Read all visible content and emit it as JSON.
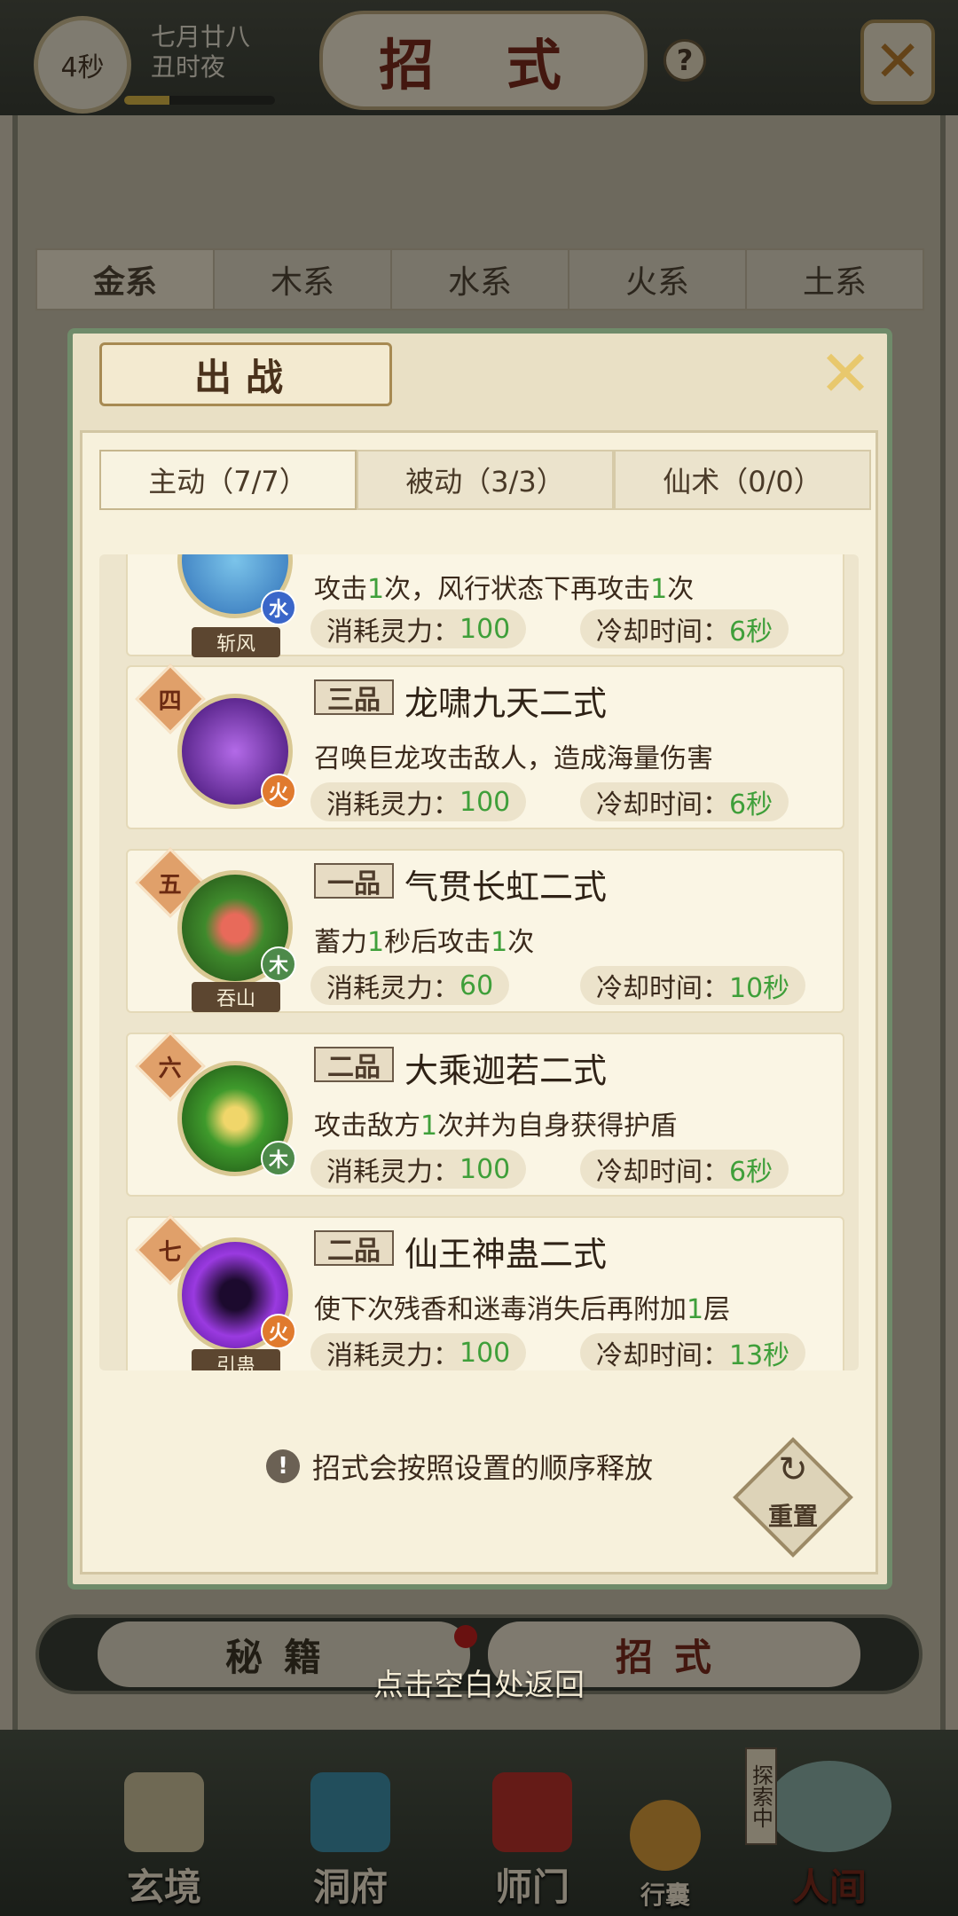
{
  "status": {
    "timer": "4秒",
    "date_line1": "七月廿八",
    "date_line2": "丑时夜"
  },
  "page_title": "招 式",
  "element_tabs": [
    "金系",
    "木系",
    "水系",
    "火系",
    "土系"
  ],
  "bottom_tabs": {
    "left": "秘籍",
    "right": "招式"
  },
  "nav": {
    "items": [
      "玄境",
      "洞府",
      "师门",
      "行囊",
      "人间"
    ],
    "explore_badge": "探索中"
  },
  "dialog": {
    "title": "出战",
    "tabs": [
      "主动（7/7）",
      "被动（3/3）",
      "仙术（0/0）"
    ],
    "cost_label": "消耗灵力：",
    "cooldown_label": "冷却时间：",
    "skills": [
      {
        "rank": "",
        "grade": "",
        "name": "",
        "desc": [
          "攻击",
          "1",
          "次，风行状态下再攻击",
          "1",
          "次"
        ],
        "cost": "100",
        "cooldown": "6秒",
        "element": "水",
        "tag": "斩风",
        "element_color": "#3a66c9",
        "icon_color": "#2f6fb7"
      },
      {
        "rank": "四",
        "grade": "三品",
        "name": "龙啸九天二式",
        "desc": [
          "召唤巨龙攻击敌人，造成海量伤害"
        ],
        "cost": "100",
        "cooldown": "6秒",
        "element": "火",
        "tag": "",
        "element_color": "#e07a2e",
        "icon_color": "#6a2aa8"
      },
      {
        "rank": "五",
        "grade": "一品",
        "name": "气贯长虹二式",
        "desc": [
          "蓄力",
          "1",
          "秒后攻击",
          "1",
          "次"
        ],
        "cost": "60",
        "cooldown": "10秒",
        "element": "木",
        "tag": "吞山",
        "element_color": "#4d8a4a",
        "icon_color": "#3f8a2c"
      },
      {
        "rank": "六",
        "grade": "二品",
        "name": "大乘迦若二式",
        "desc": [
          "攻击敌方",
          "1",
          "次并为自身获得护盾"
        ],
        "cost": "100",
        "cooldown": "6秒",
        "element": "木",
        "tag": "",
        "element_color": "#4d8a4a",
        "icon_color": "#2f7a2c"
      },
      {
        "rank": "七",
        "grade": "二品",
        "name": "仙王神蛊二式",
        "desc": [
          "使下次残香和迷毒消失后再附加",
          "1",
          "层"
        ],
        "cost": "100",
        "cooldown": "13秒",
        "element": "火",
        "tag": "引蛊",
        "element_color": "#e07a2e",
        "icon_color": "#7a2ab8"
      }
    ],
    "hint": "招式会按照设置的顺序释放",
    "reset_label": "重置"
  },
  "back_hint": "点击空白处返回",
  "colors": {
    "accent_green": "#3f9f3a",
    "title_red": "#7a2a1c",
    "frame_green": "#6f8b6a"
  }
}
